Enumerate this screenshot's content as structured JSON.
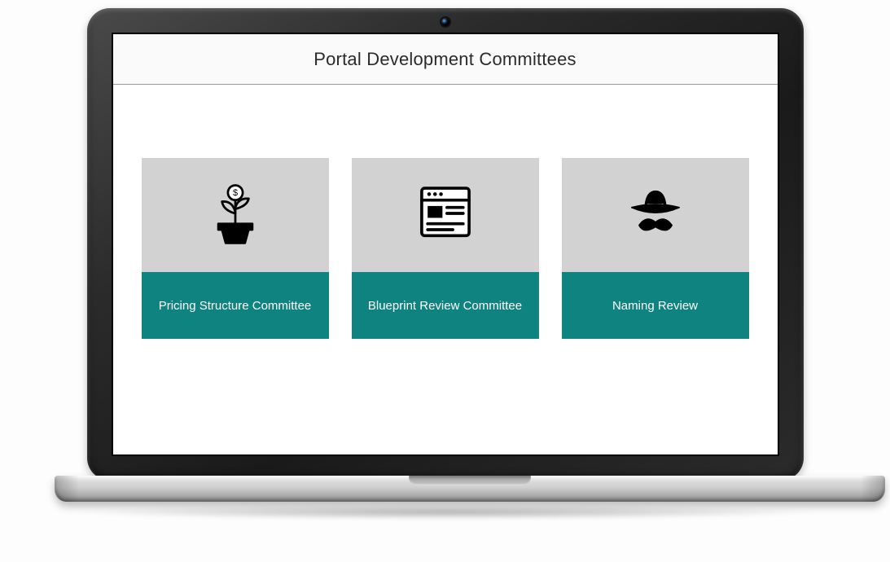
{
  "colors": {
    "card_bg": "#d2d2d2",
    "card_label_bg": "#0f8380",
    "card_label_text": "#ffffff",
    "header_border": "#9a9a9a"
  },
  "header": {
    "title": "Portal Development Committees"
  },
  "cards": [
    {
      "icon": "money-plant-icon",
      "label": "Pricing Structure Committee"
    },
    {
      "icon": "webpage-icon",
      "label": "Blueprint Review Committee"
    },
    {
      "icon": "hat-mustache-icon",
      "label": "Naming Review"
    }
  ]
}
